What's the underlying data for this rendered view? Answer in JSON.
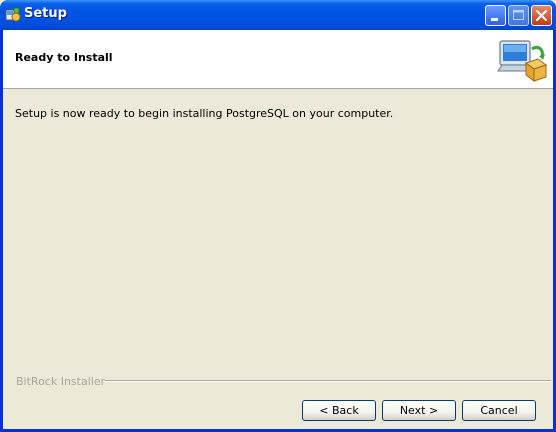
{
  "window": {
    "title": "Setup",
    "icons": {
      "app": "setup-icon",
      "minimize": "minimize-icon",
      "maximize": "maximize-icon",
      "close": "close-icon",
      "header": "computer-install-icon"
    }
  },
  "header": {
    "title": "Ready to Install"
  },
  "main": {
    "message": "Setup is now ready to begin installing PostgreSQL on your computer."
  },
  "footer": {
    "brand": "BitRock Installer",
    "back_label": "< Back",
    "next_label": "Next >",
    "cancel_label": "Cancel"
  },
  "colors": {
    "titlebar": "#0054E3",
    "dialog_bg": "#ECE9D8",
    "header_bg": "#FFFFFF",
    "close_button": "#C33A16"
  }
}
